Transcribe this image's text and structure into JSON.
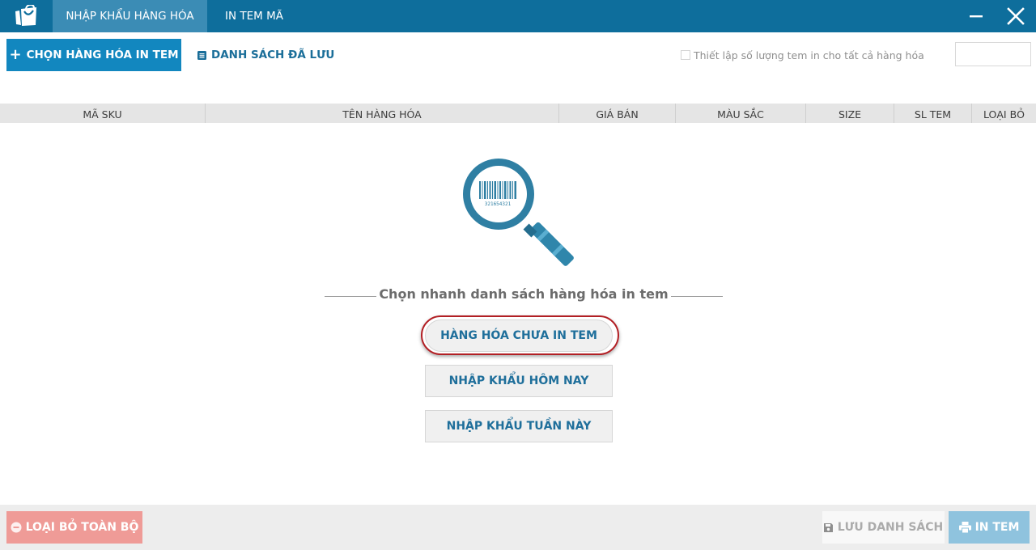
{
  "titlebar": {
    "logo_icon": "shopping-bag-icon",
    "tabs": [
      {
        "label": "NHẬP KHẨU HÀNG HÓA",
        "active": true
      },
      {
        "label": "IN TEM MÃ",
        "active": false
      }
    ],
    "minimize_icon": "minimize-icon",
    "close_icon": "close-icon",
    "background": "#0e6e9c",
    "active_tab_background": "#3b8cb5"
  },
  "toolbar": {
    "choose_button_label": "CHỌN HÀNG HÓA IN TEM",
    "choose_button_icon": "plus-icon",
    "saved_list_label": "DANH SÁCH ĐÃ LƯU",
    "saved_list_icon": "list-icon",
    "set_quantity_checkbox_label": "Thiết lập số lượng tem in cho tất cả hàng hóa",
    "set_quantity_checked": false,
    "quantity_value": "",
    "accent": "#1287bf"
  },
  "table": {
    "columns": [
      "MÃ SKU",
      "TÊN HÀNG HÓA",
      "GIÁ BÁN",
      "MÀU SẮC",
      "SIZE",
      "SL TEM",
      "LOẠI BỎ"
    ],
    "rows": []
  },
  "empty_state": {
    "illustration_icon": "barcode-magnifier-icon",
    "barcode_number": "321654321",
    "title": "Chọn nhanh danh sách hàng hóa in tem",
    "quick_buttons": [
      {
        "label": "HÀNG HÓA CHƯA IN TEM",
        "highlighted": true
      },
      {
        "label": "NHẬP KHẨU HÔM NAY",
        "highlighted": false
      },
      {
        "label": "NHẬP KHẨU TUẦN NÀY",
        "highlighted": false
      }
    ],
    "highlight_color": "#b21f24"
  },
  "footer": {
    "remove_all_label": "LOẠI BỎ TOÀN BỘ",
    "remove_all_icon": "minus-circle-icon",
    "remove_all_color": "#ef9b97",
    "save_list_label": "LƯU DANH SÁCH",
    "save_list_icon": "floppy-disk-icon",
    "print_label": "IN TEM",
    "print_icon": "printer-icon",
    "print_color": "#8fc3de"
  }
}
